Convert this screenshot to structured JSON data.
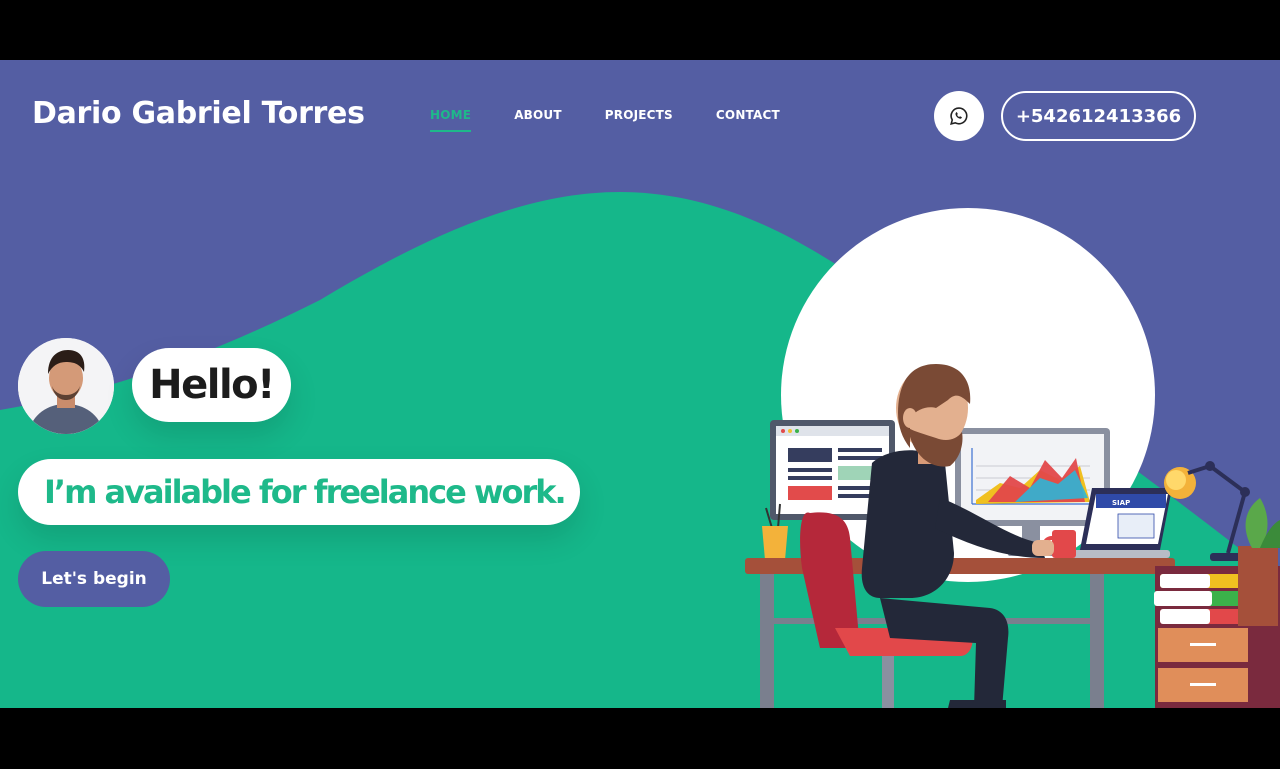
{
  "header": {
    "brand": "Dario Gabriel Torres",
    "nav": [
      {
        "label": "HOME",
        "active": true
      },
      {
        "label": "ABOUT",
        "active": false
      },
      {
        "label": "PROJECTS",
        "active": false
      },
      {
        "label": "CONTACT",
        "active": false
      }
    ],
    "whatsapp_icon": "whatsapp-icon",
    "phone": "+542612413366"
  },
  "hero": {
    "greeting": "Hello!",
    "tagline": "I’m available for freelance work.",
    "cta": "Let's begin"
  },
  "laptop_screen_text": "SIAP",
  "colors": {
    "primary": "#545ea3",
    "accent": "#1eb98a",
    "white": "#ffffff"
  }
}
